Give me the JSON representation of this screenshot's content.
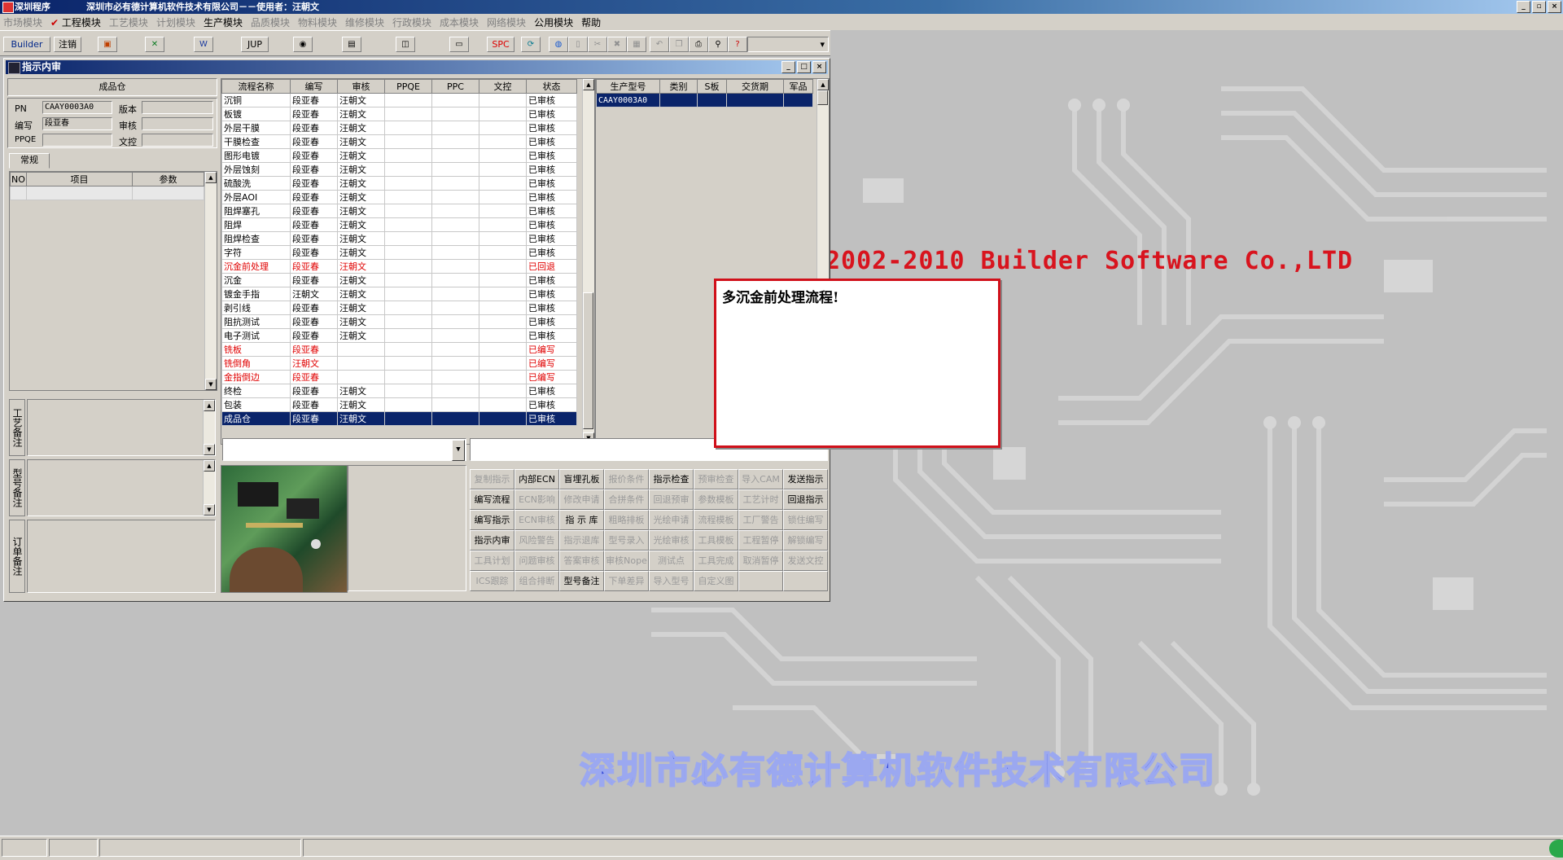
{
  "titlebar": {
    "app": "深圳程序",
    "title": "深圳市必有德计算机软件技术有限公司－－使用者：汪朝文"
  },
  "menu": [
    "市场模块",
    "工程模块",
    "工艺模块",
    "计划模块",
    "生产模块",
    "品质模块",
    "物料模块",
    "维修模块",
    "行政模块",
    "成本模块",
    "网络模块",
    "公用模块",
    "帮助"
  ],
  "toolbar": {
    "builder": "Builder",
    "logout": "注销",
    "jup": "JUP",
    "spc": "SPC"
  },
  "colors": {
    "accent": "#0a246a",
    "red": "#e00000"
  },
  "window": {
    "title": "指示内审",
    "store_header": "成品仓",
    "pn_label": "PN",
    "pn_value": "CAAY0003A0",
    "version_label": "版本",
    "version_value": "",
    "writer_label": "编写",
    "writer_value": "段亚春",
    "review_label": "审核",
    "review_value": "",
    "ppqe_label": "PPQE",
    "ppqe_value": "",
    "doc_label": "文控",
    "doc_value": "",
    "tab_general": "常规",
    "param_headers": [
      "NO",
      "项目",
      "参数"
    ],
    "side_labels": [
      "工艺备注",
      "型号备注",
      "订单备注"
    ]
  },
  "flow": {
    "headers": [
      "流程名称",
      "编写",
      "审核",
      "PPQE",
      "PPC",
      "文控",
      "状态"
    ],
    "rows": [
      {
        "name": "沉铜",
        "writer": "段亚春",
        "reviewer": "汪朝文",
        "status": "已审核",
        "red": false
      },
      {
        "name": "板镀",
        "writer": "段亚春",
        "reviewer": "汪朝文",
        "status": "已审核",
        "red": false
      },
      {
        "name": "外层干膜",
        "writer": "段亚春",
        "reviewer": "汪朝文",
        "status": "已审核",
        "red": false
      },
      {
        "name": "干膜检查",
        "writer": "段亚春",
        "reviewer": "汪朝文",
        "status": "已审核",
        "red": false
      },
      {
        "name": "图形电镀",
        "writer": "段亚春",
        "reviewer": "汪朝文",
        "status": "已审核",
        "red": false
      },
      {
        "name": "外层蚀刻",
        "writer": "段亚春",
        "reviewer": "汪朝文",
        "status": "已审核",
        "red": false
      },
      {
        "name": "硫酸洗",
        "writer": "段亚春",
        "reviewer": "汪朝文",
        "status": "已审核",
        "red": false
      },
      {
        "name": "外层AOI",
        "writer": "段亚春",
        "reviewer": "汪朝文",
        "status": "已审核",
        "red": false
      },
      {
        "name": "阻焊塞孔",
        "writer": "段亚春",
        "reviewer": "汪朝文",
        "status": "已审核",
        "red": false
      },
      {
        "name": "阻焊",
        "writer": "段亚春",
        "reviewer": "汪朝文",
        "status": "已审核",
        "red": false
      },
      {
        "name": "阻焊检查",
        "writer": "段亚春",
        "reviewer": "汪朝文",
        "status": "已审核",
        "red": false
      },
      {
        "name": "字符",
        "writer": "段亚春",
        "reviewer": "汪朝文",
        "status": "已审核",
        "red": false
      },
      {
        "name": "沉金前处理",
        "writer": "段亚春",
        "reviewer": "汪朝文",
        "status": "已回退",
        "red": true
      },
      {
        "name": "沉金",
        "writer": "段亚春",
        "reviewer": "汪朝文",
        "status": "已审核",
        "red": false
      },
      {
        "name": "镀金手指",
        "writer": "汪朝文",
        "reviewer": "汪朝文",
        "status": "已审核",
        "red": false
      },
      {
        "name": "剥引线",
        "writer": "段亚春",
        "reviewer": "汪朝文",
        "status": "已审核",
        "red": false
      },
      {
        "name": "阻抗测试",
        "writer": "段亚春",
        "reviewer": "汪朝文",
        "status": "已审核",
        "red": false
      },
      {
        "name": "电子测试",
        "writer": "段亚春",
        "reviewer": "汪朝文",
        "status": "已审核",
        "red": false
      },
      {
        "name": "铣板",
        "writer": "段亚春",
        "reviewer": "",
        "status": "已编写",
        "red": true
      },
      {
        "name": "铣倒角",
        "writer": "汪朝文",
        "reviewer": "",
        "status": "已编写",
        "red": true
      },
      {
        "name": "金指倒边",
        "writer": "段亚春",
        "reviewer": "",
        "status": "已编写",
        "red": true
      },
      {
        "name": "终检",
        "writer": "段亚春",
        "reviewer": "汪朝文",
        "status": "已审核",
        "red": false
      },
      {
        "name": "包装",
        "writer": "段亚春",
        "reviewer": "汪朝文",
        "status": "已审核",
        "red": false
      },
      {
        "name": "成品仓",
        "writer": "段亚春",
        "reviewer": "汪朝文",
        "status": "已审核",
        "red": false,
        "selected": true
      }
    ]
  },
  "orders": {
    "headers": [
      "生产型号",
      "类别",
      "S板",
      "交货期",
      "军品"
    ],
    "rows": [
      {
        "model": "CAAY0003A0"
      }
    ]
  },
  "buttons": [
    {
      "label": "复制指示",
      "enabled": false
    },
    {
      "label": "内部ECN",
      "enabled": true
    },
    {
      "label": "盲埋孔板",
      "enabled": true
    },
    {
      "label": "报价条件",
      "enabled": false
    },
    {
      "label": "指示检查",
      "enabled": true
    },
    {
      "label": "预审检查",
      "enabled": false
    },
    {
      "label": "导入CAM",
      "enabled": false
    },
    {
      "label": "发送指示",
      "enabled": true
    },
    {
      "label": "编写流程",
      "enabled": true
    },
    {
      "label": "ECN影响",
      "enabled": false
    },
    {
      "label": "修改申请",
      "enabled": false
    },
    {
      "label": "合拼条件",
      "enabled": false
    },
    {
      "label": "回退预审",
      "enabled": false
    },
    {
      "label": "参数模板",
      "enabled": false
    },
    {
      "label": "工艺计时",
      "enabled": false
    },
    {
      "label": "回退指示",
      "enabled": true
    },
    {
      "label": "编写指示",
      "enabled": true
    },
    {
      "label": "ECN审核",
      "enabled": false
    },
    {
      "label": "指 示 库",
      "enabled": true
    },
    {
      "label": "粗略排板",
      "enabled": false
    },
    {
      "label": "光绘申请",
      "enabled": false
    },
    {
      "label": "流程模板",
      "enabled": false
    },
    {
      "label": "工厂警告",
      "enabled": false
    },
    {
      "label": "锁住编写",
      "enabled": false
    },
    {
      "label": "指示内审",
      "enabled": true
    },
    {
      "label": "风险警告",
      "enabled": false
    },
    {
      "label": "指示退库",
      "enabled": false
    },
    {
      "label": "型号录入",
      "enabled": false
    },
    {
      "label": "光绘审核",
      "enabled": false
    },
    {
      "label": "工具模板",
      "enabled": false
    },
    {
      "label": "工程暂停",
      "enabled": false
    },
    {
      "label": "解锁编写",
      "enabled": false
    },
    {
      "label": "工具计划",
      "enabled": false
    },
    {
      "label": "问题审核",
      "enabled": false
    },
    {
      "label": "答案审核",
      "enabled": false
    },
    {
      "label": "审核Nope",
      "enabled": false
    },
    {
      "label": "测试点",
      "enabled": false
    },
    {
      "label": "工具完成",
      "enabled": false
    },
    {
      "label": "取消暂停",
      "enabled": false
    },
    {
      "label": "发送文控",
      "enabled": false
    },
    {
      "label": "ICS跟踪",
      "enabled": false
    },
    {
      "label": "组合排断",
      "enabled": false
    },
    {
      "label": "型号备注",
      "enabled": true
    },
    {
      "label": "下单差异",
      "enabled": false
    },
    {
      "label": "导入型号",
      "enabled": false
    },
    {
      "label": "自定义图",
      "enabled": false
    },
    {
      "label": "",
      "enabled": false
    },
    {
      "label": "",
      "enabled": false
    }
  ],
  "popup": {
    "message": "多沉金前处理流程!"
  },
  "desktop": {
    "copyright": "2002-2010 Builder Software Co.,LTD",
    "company": "深圳市必有德计算机软件技术有限公司"
  }
}
